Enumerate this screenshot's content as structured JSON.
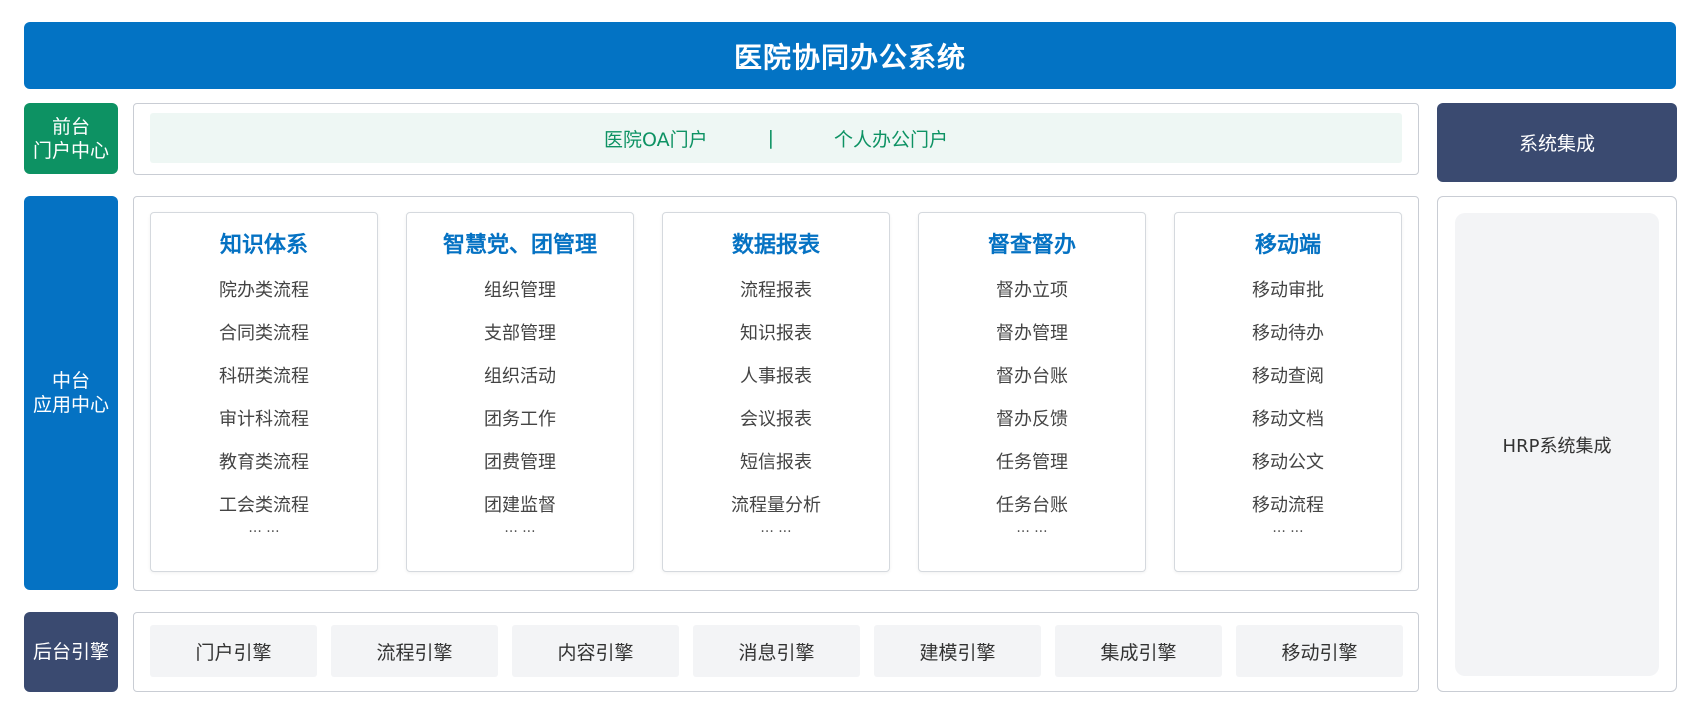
{
  "title": "医院协同办公系统",
  "layers": {
    "front": {
      "label_line1": "前台",
      "label_line2": "门户中心"
    },
    "middle": {
      "label_line1": "中台",
      "label_line2": "应用中心"
    },
    "back": {
      "label": "后台引擎"
    }
  },
  "portal": {
    "item1": "医院OA门户",
    "separator": "|",
    "item2": "个人办公门户"
  },
  "modules": [
    {
      "title": "知识体系",
      "items": [
        "院办类流程",
        "合同类流程",
        "科研类流程",
        "审计科流程",
        "教育类流程",
        "工会类流程"
      ],
      "more": "... ..."
    },
    {
      "title": "智慧党、团管理",
      "items": [
        "组织管理",
        "支部管理",
        "组织活动",
        "团务工作",
        "团费管理",
        "团建监督"
      ],
      "more": "... ..."
    },
    {
      "title": "数据报表",
      "items": [
        "流程报表",
        "知识报表",
        "人事报表",
        "会议报表",
        "短信报表",
        "流程量分析"
      ],
      "more": "... ..."
    },
    {
      "title": "督查督办",
      "items": [
        "督办立项",
        "督办管理",
        "督办台账",
        "督办反馈",
        "任务管理",
        "任务台账"
      ],
      "more": "... ..."
    },
    {
      "title": "移动端",
      "items": [
        "移动审批",
        "移动待办",
        "移动查阅",
        "移动文档",
        "移动公文",
        "移动流程"
      ],
      "more": "... ..."
    }
  ],
  "engines": [
    "门户引擎",
    "流程引擎",
    "内容引擎",
    "消息引擎",
    "建模引擎",
    "集成引擎",
    "移动引擎"
  ],
  "integration": {
    "header": "系统集成",
    "hrp": "HRP系统集成"
  },
  "colors": {
    "title_blue": "#0373C4",
    "front_green": "#0D9263",
    "middle_blue": "#0572C3",
    "back_navy": "#3A4A70",
    "portal_bg": "#EEF7F4",
    "engine_bg": "#F3F4F6"
  }
}
